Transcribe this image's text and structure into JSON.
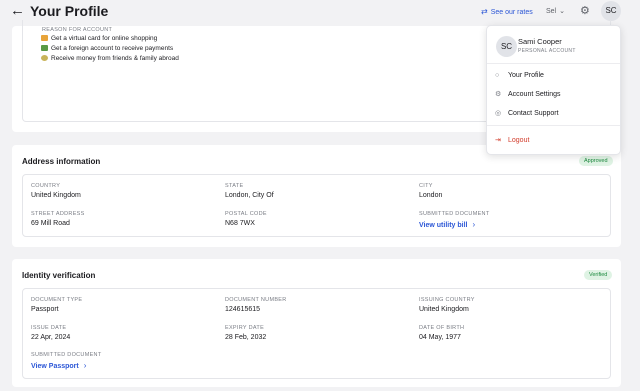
{
  "header": {
    "title": "Your Profile",
    "back_icon": "arrow-left-icon",
    "rates_link": "See our rates",
    "language": "Sel",
    "avatar_initials": "SC"
  },
  "reason_section": {
    "heading": "REASON FOR ACCOUNT",
    "items": [
      "Get a virtual card for online shopping",
      "Get a foreign account to receive payments",
      "Receive money from friends & family abroad"
    ]
  },
  "address": {
    "title": "Address information",
    "badge": "Approved",
    "fields": {
      "country_label": "COUNTRY",
      "country": "United Kingdom",
      "state_label": "STATE",
      "state": "London, City Of",
      "city_label": "CITY",
      "city": "London",
      "street_label": "STREET ADDRESS",
      "street": "69 Mill Road",
      "postal_label": "POSTAL CODE",
      "postal": "N68 7WX",
      "doc_label": "SUBMITTED DOCUMENT",
      "doc_link": "View utility bill"
    }
  },
  "identity": {
    "title": "Identity verification",
    "badge": "Verified",
    "fields": {
      "doc_type_label": "DOCUMENT TYPE",
      "doc_type": "Passport",
      "doc_number_label": "DOCUMENT NUMBER",
      "doc_number": "124615615",
      "issuing_label": "ISSUING COUNTRY",
      "issuing": "United Kingdom",
      "issue_date_label": "ISSUE DATE",
      "issue_date": "22 Apr, 2024",
      "expiry_label": "EXPIRY DATE",
      "expiry": "28 Feb, 2032",
      "dob_label": "DATE OF BIRTH",
      "dob": "04 May, 1977",
      "doc_label": "SUBMITTED DOCUMENT",
      "doc_link": "View Passport"
    }
  },
  "menu": {
    "initials": "SC",
    "name": "Sami Cooper",
    "account_type": "PERSONAL ACCOUNT",
    "items": [
      "Your Profile",
      "Account Settings",
      "Contact Support"
    ],
    "logout": "Logout"
  },
  "colors": {
    "accent": "#2c57d6",
    "approved_badge": "#1c8a3e",
    "logout": "#d23b2a"
  }
}
